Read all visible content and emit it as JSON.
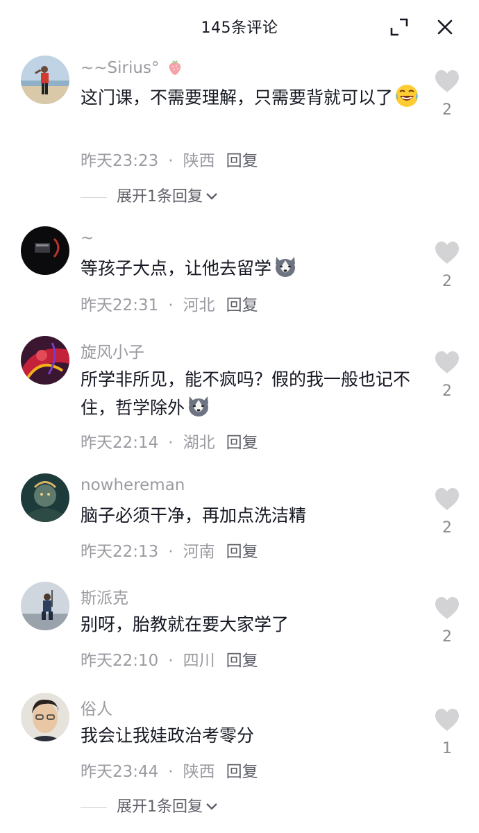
{
  "header": {
    "title": "145条评论"
  },
  "comments": [
    {
      "username": "~~Sirius°",
      "text": "这门课，不需要理解，只需要背就可以了",
      "emoji": "laugh-cry-emoji",
      "time": "昨天23:23",
      "location": "陕西",
      "reply_label": "回复",
      "expand_label": "展开1条回复",
      "likes": "2"
    },
    {
      "username": "~",
      "text": "等孩子大点，让他去留学",
      "emoji": "husky-emoji",
      "time": "昨天22:31",
      "location": "河北",
      "reply_label": "回复",
      "likes": "2"
    },
    {
      "username": "旋风小子",
      "text": "所学非所见，能不疯吗？假的我一般也记不住，哲学除外",
      "emoji": "husky-emoji",
      "time": "昨天22:14",
      "location": "湖北",
      "reply_label": "回复",
      "likes": "2"
    },
    {
      "username": "nowhereman",
      "text": "脑子必须干净，再加点洗洁精",
      "time": "昨天22:13",
      "location": "河南",
      "reply_label": "回复",
      "likes": "2"
    },
    {
      "username": "斯派克",
      "text": "别呀，胎教就在要大家学了",
      "time": "昨天22:10",
      "location": "四川",
      "reply_label": "回复",
      "likes": "2"
    },
    {
      "username": "俗人",
      "text": "我会让我娃政治考零分",
      "time": "昨天23:44",
      "location": "陕西",
      "reply_label": "回复",
      "expand_label": "展开1条回复",
      "likes": "1"
    }
  ],
  "colors": {
    "primary_text": "#161823",
    "secondary_text": "#9a9ba1",
    "reply_text": "#5f6069",
    "heart": "#d3d3d6"
  }
}
